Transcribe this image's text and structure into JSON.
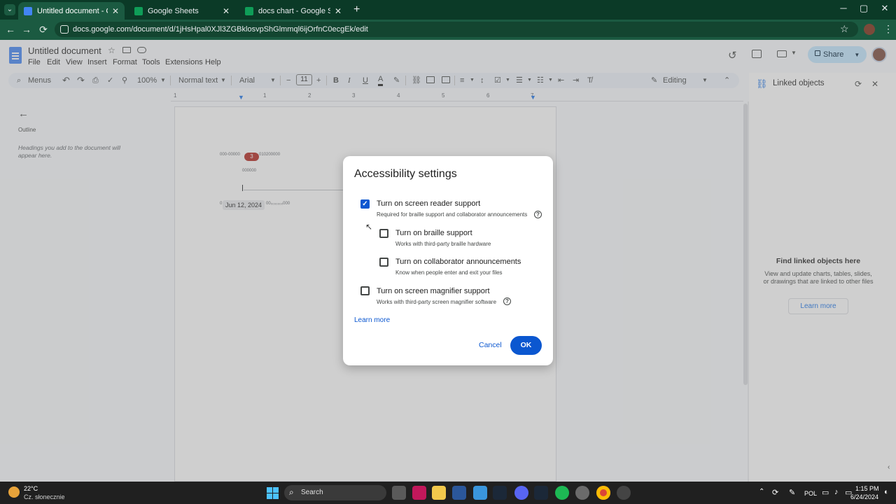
{
  "browser": {
    "tabs": [
      {
        "title": "Untitled document - Google D...",
        "active": true,
        "icon": "docs-favicon",
        "color": "#4285f4"
      },
      {
        "title": "Google Sheets",
        "active": false,
        "icon": "sheets-favicon",
        "color": "#0f9d58"
      },
      {
        "title": "docs chart - Google Sheets",
        "active": false,
        "icon": "sheets-favicon",
        "color": "#0f9d58"
      }
    ],
    "new_tab": "+",
    "window_controls": {
      "minimize": "─",
      "maximize": "▢",
      "close": "✕"
    },
    "url": "docs.google.com/document/d/1jHsHpal0XJl3ZGBklosvpShGlmmql6ijOrfnC0ecgEk/edit",
    "nav": {
      "back": "←",
      "forward": "→",
      "reload": "⟳"
    },
    "bookmark_icon": "☆",
    "menu_icon": "⋮"
  },
  "docs": {
    "title": "Untitled document",
    "menus": [
      "File",
      "Edit",
      "View",
      "Insert",
      "Format",
      "Tools",
      "Extensions",
      "Help"
    ],
    "share_label": "Share",
    "toolbar": {
      "search_menus": "Menus",
      "zoom": "100%",
      "style": "Normal text",
      "font": "Arial",
      "font_size": "11",
      "mode": "Editing"
    },
    "ruler_numbers": [
      "1",
      "1",
      "2",
      "3",
      "4",
      "5",
      "6",
      "7"
    ],
    "outline": {
      "label": "Outline",
      "empty_text": "Headings you add to the document will appear here."
    },
    "page": {
      "chip_text": "Jun 12, 2024",
      "badge": "3"
    }
  },
  "side_panel": {
    "title": "Linked objects",
    "heading": "Find linked objects here",
    "description": "View and update charts, tables, slides, or drawings that are linked to other files",
    "learn_more": "Learn more"
  },
  "dialog": {
    "title": "Accessibility settings",
    "options": [
      {
        "label": "Turn on screen reader support",
        "desc": "Required for braille support and collaborator announcements",
        "checked": true
      },
      {
        "label": "Turn on braille support",
        "desc": "Works with third-party braille hardware",
        "checked": false
      },
      {
        "label": "Turn on collaborator announcements",
        "desc": "Know when people enter and exit your files",
        "checked": false
      },
      {
        "label": "Turn on screen magnifier support",
        "desc": "Works with third-party screen magnifier software",
        "checked": false
      }
    ],
    "learn_more": "Learn more",
    "cancel": "Cancel",
    "ok": "OK"
  },
  "taskbar": {
    "weather_temp": "22°C",
    "weather_desc": "Cz. słonecznie",
    "search": "Search",
    "language": "POL",
    "time": "1:15 PM",
    "date": "6/24/2024"
  }
}
